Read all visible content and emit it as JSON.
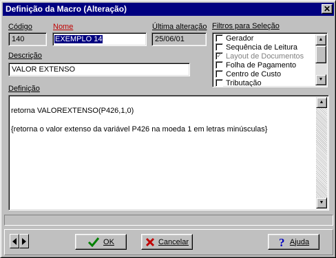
{
  "window": {
    "title": "Definição da Macro (Alteração)",
    "close_glyph": "✕"
  },
  "fields": {
    "codigo": {
      "label": "Código",
      "value": "140"
    },
    "nome": {
      "label": "Nome",
      "value": "EXEMPLO 14"
    },
    "ultima_alteracao": {
      "label": "Última alteração",
      "value": "25/06/01"
    },
    "descricao": {
      "label": "Descrição",
      "value": "VALOR EXTENSO"
    }
  },
  "filtros": {
    "label": "Filtros para Seleção",
    "items": [
      {
        "label": "Gerador",
        "checked": false,
        "disabled": false
      },
      {
        "label": "Sequência de Leitura",
        "checked": false,
        "disabled": false
      },
      {
        "label": "Layout de Documentos",
        "checked": true,
        "disabled": true
      },
      {
        "label": "Folha de Pagamento",
        "checked": false,
        "disabled": false
      },
      {
        "label": "Centro de Custo",
        "checked": false,
        "disabled": false
      },
      {
        "label": "Tributação",
        "checked": false,
        "disabled": false
      }
    ]
  },
  "definicao": {
    "label": "Definição",
    "lines": [
      "retorna VALOREXTENSO(P426,1,0)",
      "{retorna o valor extenso da variável P426 na moeda 1 em letras minúsculas}"
    ]
  },
  "buttons": {
    "ok": "OK",
    "cancelar": "Cancelar",
    "ajuda": "Ajuda"
  },
  "colors": {
    "title_bg": "#000080",
    "dialog_bg": "#c0c0c0",
    "ok_check": "#008000",
    "cancel_x": "#c00000",
    "help_q": "#0000c0"
  }
}
